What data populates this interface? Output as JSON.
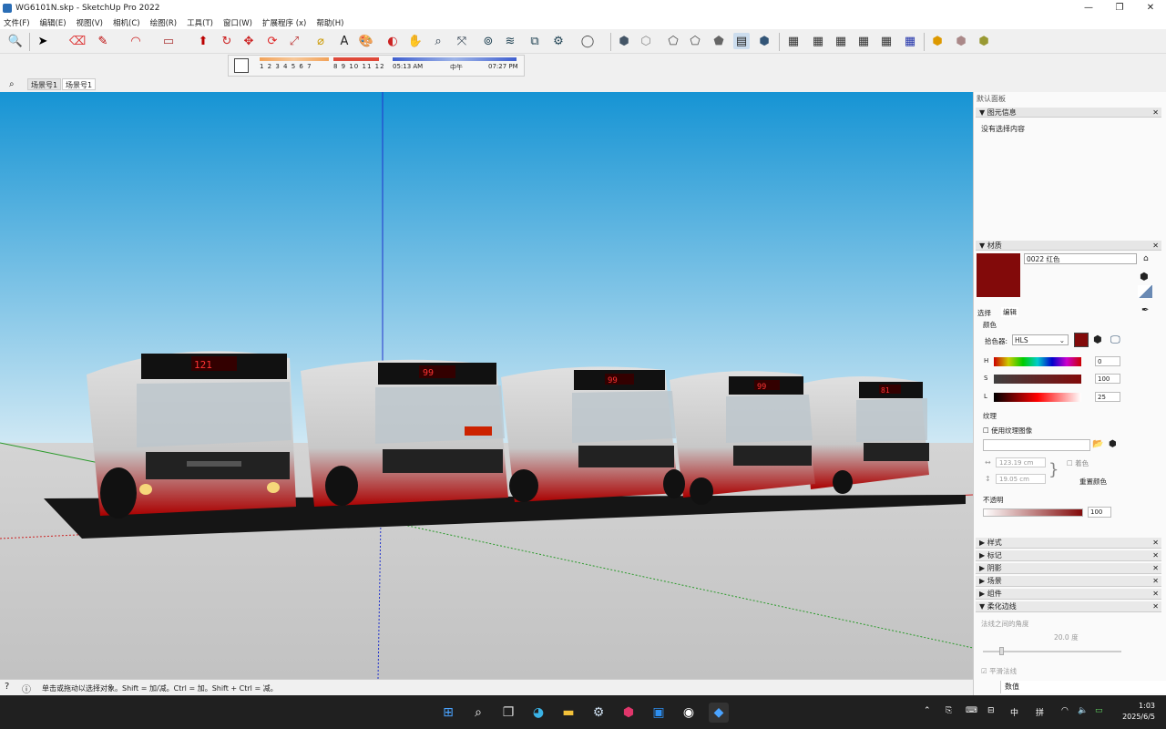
{
  "window": {
    "title": "WG6101N.skp - SketchUp Pro 2022",
    "min": "—",
    "restore": "❐",
    "close": "✕"
  },
  "menu": [
    "文件(F)",
    "编辑(E)",
    "视图(V)",
    "相机(C)",
    "绘图(R)",
    "工具(T)",
    "窗口(W)",
    "扩展程序 (x)",
    "帮助(H)"
  ],
  "shadow": {
    "months_a": "1 2 3 4 5 6 7",
    "months_b": "8 9 10 11 12",
    "time_start": "05:13 AM",
    "time_mid": "中午",
    "time_end": "07:27 PM"
  },
  "scenes": {
    "tab1": "场景号1",
    "tab2": "场景号1"
  },
  "bus_displays": [
    "121",
    "99",
    "99",
    "99",
    "81"
  ],
  "panel": {
    "tray_title": "默认面板",
    "entity_info": {
      "header": "图元信息",
      "text": "没有选择内容"
    },
    "materials": {
      "header": "材质",
      "name": "0022 红色",
      "tab_select": "选择",
      "tab_edit": "编辑",
      "color_label": "颜色",
      "picker_label": "拾色器:",
      "picker_value": "HLS",
      "h_label": "H",
      "h_value": "0",
      "s_label": "S",
      "s_value": "100",
      "l_label": "L",
      "l_value": "25",
      "texture_label": "纹理",
      "use_texture": "使用纹理图像",
      "width": "123.19 cm",
      "height": "19.05 cm",
      "colorize": "着色",
      "reset": "重置颜色",
      "opacity_label": "不透明",
      "opacity_value": "100",
      "swatch_color": "#820a0a"
    },
    "collapsed": [
      "样式",
      "标记",
      "阴影",
      "场景",
      "组件",
      "柔化边线"
    ],
    "soften": {
      "normals": "法线之间的角度",
      "angle": "20.0 度",
      "smooth": "平滑法线"
    }
  },
  "status": {
    "text": "单击或拖动以选择对象。Shift = 加/减。Ctrl = 加。Shift + Ctrl = 减。",
    "measure_label": "数值"
  },
  "clock": {
    "time": "1:03",
    "date": "2025/6/5"
  },
  "tray": {
    "ime": "中",
    "layout": "拼"
  }
}
